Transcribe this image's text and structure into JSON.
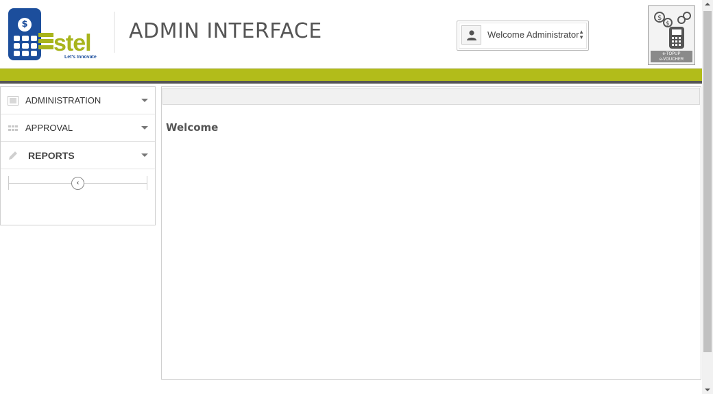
{
  "header": {
    "logo_text": "stel",
    "logo_tagline": "Let's Innovate",
    "title": "ADMIN INTERFACE",
    "user_menu": {
      "label": "Welcome Administrator"
    },
    "brand_badge": {
      "line1": "e-TOPUP",
      "line2": "e-VOUCHER"
    }
  },
  "sidebar": {
    "items": [
      {
        "label": "ADMINISTRATION",
        "icon": "image-icon"
      },
      {
        "label": "APPROVAL",
        "icon": "grid-icon"
      },
      {
        "label": "REPORTS",
        "icon": "pencil-icon"
      }
    ],
    "collapse_glyph": "‹"
  },
  "main": {
    "welcome": "Welcome"
  },
  "colors": {
    "accent_green": "#b2bc1a",
    "brand_blue": "#1c4e9c"
  }
}
